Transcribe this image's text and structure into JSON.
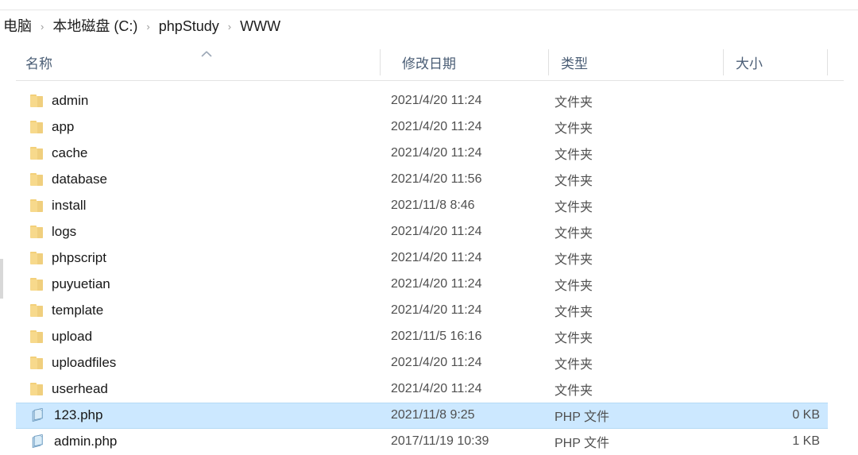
{
  "window": {
    "app": "file-explorer",
    "selection_color": "#cce8ff"
  },
  "breadcrumb": {
    "separator": "›",
    "items": [
      {
        "label": "电脑"
      },
      {
        "label": "本地磁盘 (C:)"
      },
      {
        "label": "phpStudy"
      },
      {
        "label": "WWW"
      }
    ]
  },
  "columns": {
    "name": "名称",
    "date": "修改日期",
    "type": "类型",
    "size": "大小",
    "sort_by": "name",
    "sort_direction": "ascending",
    "sort_icon": "caret-up-icon"
  },
  "rows": [
    {
      "icon": "folder-icon",
      "name": "admin",
      "date": "2021/4/20 11:24",
      "type": "文件夹",
      "size": "",
      "selected": false
    },
    {
      "icon": "folder-icon",
      "name": "app",
      "date": "2021/4/20 11:24",
      "type": "文件夹",
      "size": "",
      "selected": false
    },
    {
      "icon": "folder-icon",
      "name": "cache",
      "date": "2021/4/20 11:24",
      "type": "文件夹",
      "size": "",
      "selected": false
    },
    {
      "icon": "folder-icon",
      "name": "database",
      "date": "2021/4/20 11:56",
      "type": "文件夹",
      "size": "",
      "selected": false
    },
    {
      "icon": "folder-icon",
      "name": "install",
      "date": "2021/11/8 8:46",
      "type": "文件夹",
      "size": "",
      "selected": false
    },
    {
      "icon": "folder-icon",
      "name": "logs",
      "date": "2021/4/20 11:24",
      "type": "文件夹",
      "size": "",
      "selected": false
    },
    {
      "icon": "folder-icon",
      "name": "phpscript",
      "date": "2021/4/20 11:24",
      "type": "文件夹",
      "size": "",
      "selected": false
    },
    {
      "icon": "folder-icon",
      "name": "puyuetian",
      "date": "2021/4/20 11:24",
      "type": "文件夹",
      "size": "",
      "selected": false
    },
    {
      "icon": "folder-icon",
      "name": "template",
      "date": "2021/4/20 11:24",
      "type": "文件夹",
      "size": "",
      "selected": false
    },
    {
      "icon": "folder-icon",
      "name": "upload",
      "date": "2021/11/5 16:16",
      "type": "文件夹",
      "size": "",
      "selected": false
    },
    {
      "icon": "folder-icon",
      "name": "uploadfiles",
      "date": "2021/4/20 11:24",
      "type": "文件夹",
      "size": "",
      "selected": false
    },
    {
      "icon": "folder-icon",
      "name": "userhead",
      "date": "2021/4/20 11:24",
      "type": "文件夹",
      "size": "",
      "selected": false
    },
    {
      "icon": "php-file-icon",
      "name": "123.php",
      "date": "2021/11/8 9:25",
      "type": "PHP 文件",
      "size": "0 KB",
      "selected": true
    },
    {
      "icon": "php-file-icon",
      "name": "admin.php",
      "date": "2017/11/19 10:39",
      "type": "PHP 文件",
      "size": "1 KB",
      "selected": false
    }
  ]
}
